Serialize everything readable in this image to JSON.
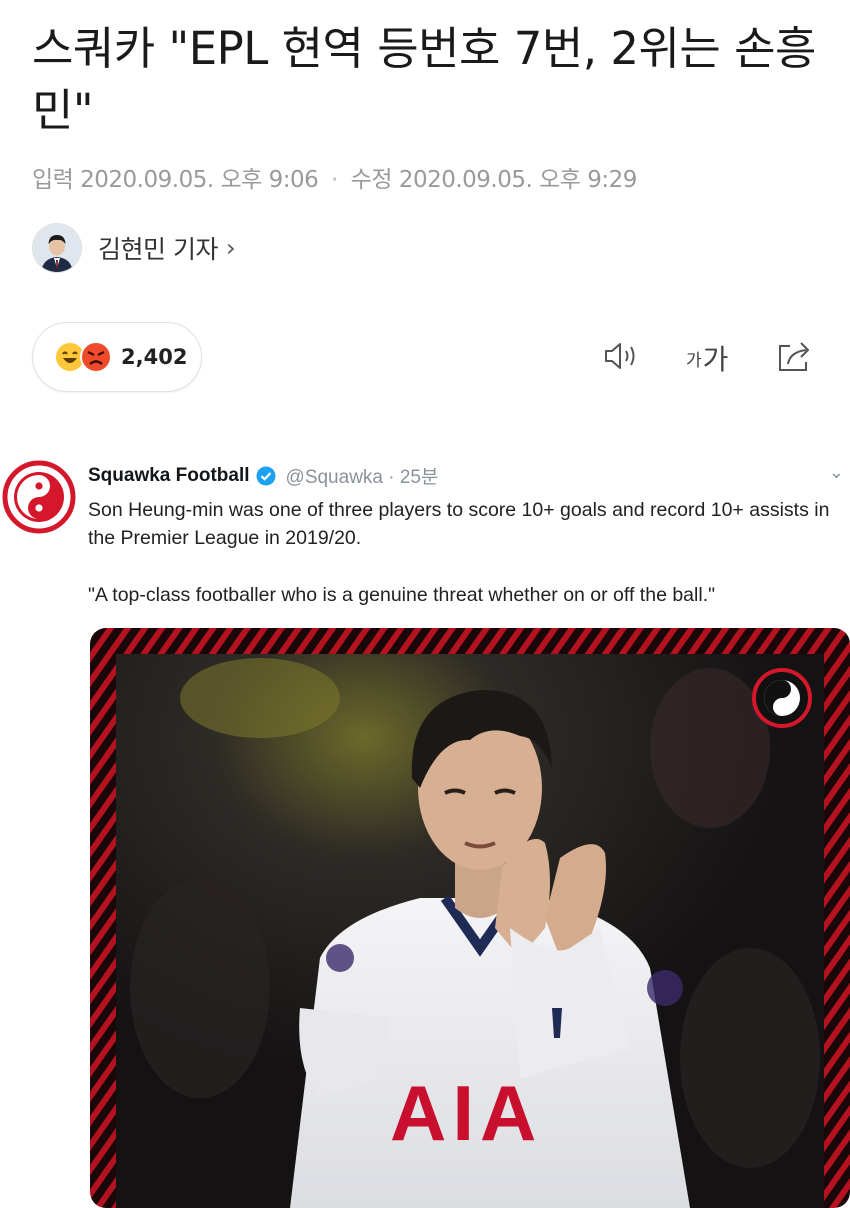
{
  "article": {
    "headline": "스쿼카 \"EPL 현역 등번호 7번, 2위는 손흥민\"",
    "meta": {
      "input_label": "입력",
      "input_time": "2020.09.05. 오후 9:06",
      "edit_label": "수정",
      "edit_time": "2020.09.05. 오후 9:29"
    },
    "author": {
      "name": "김현민 기자",
      "chevron": "›"
    }
  },
  "toolbar": {
    "reaction_count": "2,402",
    "font_size_small": "가",
    "font_size_big": "가",
    "icons": [
      "speaker-icon",
      "font-size-icon",
      "share-icon"
    ]
  },
  "tweet": {
    "name": "Squawka Football",
    "handle_time": "@Squawka · 25분",
    "text": "Son Heung-min was one of three players to score 10+ goals and record 10+ assists in the Premier League in 2019/20.",
    "quote": "\"A top-class footballer who is a genuine threat whether on or off the ball.\"",
    "shirt_sponsor": "AIA",
    "caret": "⌄"
  },
  "colors": {
    "brand_red": "#d5172c",
    "twitter_blue": "#1da1f2",
    "meta_gray": "#9a9a9a"
  }
}
